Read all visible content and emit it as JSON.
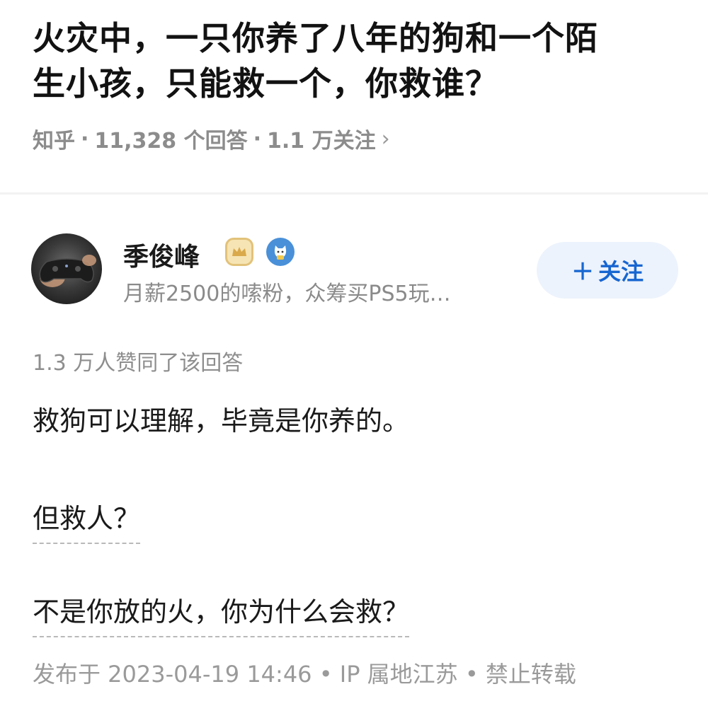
{
  "question": {
    "title_line1": "火灾中，一只你养了八年的狗和一个陌",
    "title_line2": "生小孩，只能救一个，你救谁？",
    "source": "知乎",
    "answers": "11,328 个回答",
    "followers": "1.1 万关注"
  },
  "author": {
    "name": "季俊峰",
    "bio": "月薪2500的嗦粉，众筹买PS5玩…",
    "follow_label": "关注",
    "badge_icons": [
      "crown-badge-icon",
      "cat-badge-icon"
    ]
  },
  "answer": {
    "upvote_text": "1.3 万人赞同了该回答",
    "paragraphs": [
      "救狗可以理解，毕竟是你养的。",
      "但救人？",
      "不是你放的火，你为什么会救？"
    ],
    "footer": "发布于 2023-04-19 14:46 • IP 属地江苏 • 禁止转载"
  },
  "colors": {
    "accent": "#1766d1",
    "follow_bg": "#edf3fc",
    "meta_text": "#8c8c8c"
  }
}
